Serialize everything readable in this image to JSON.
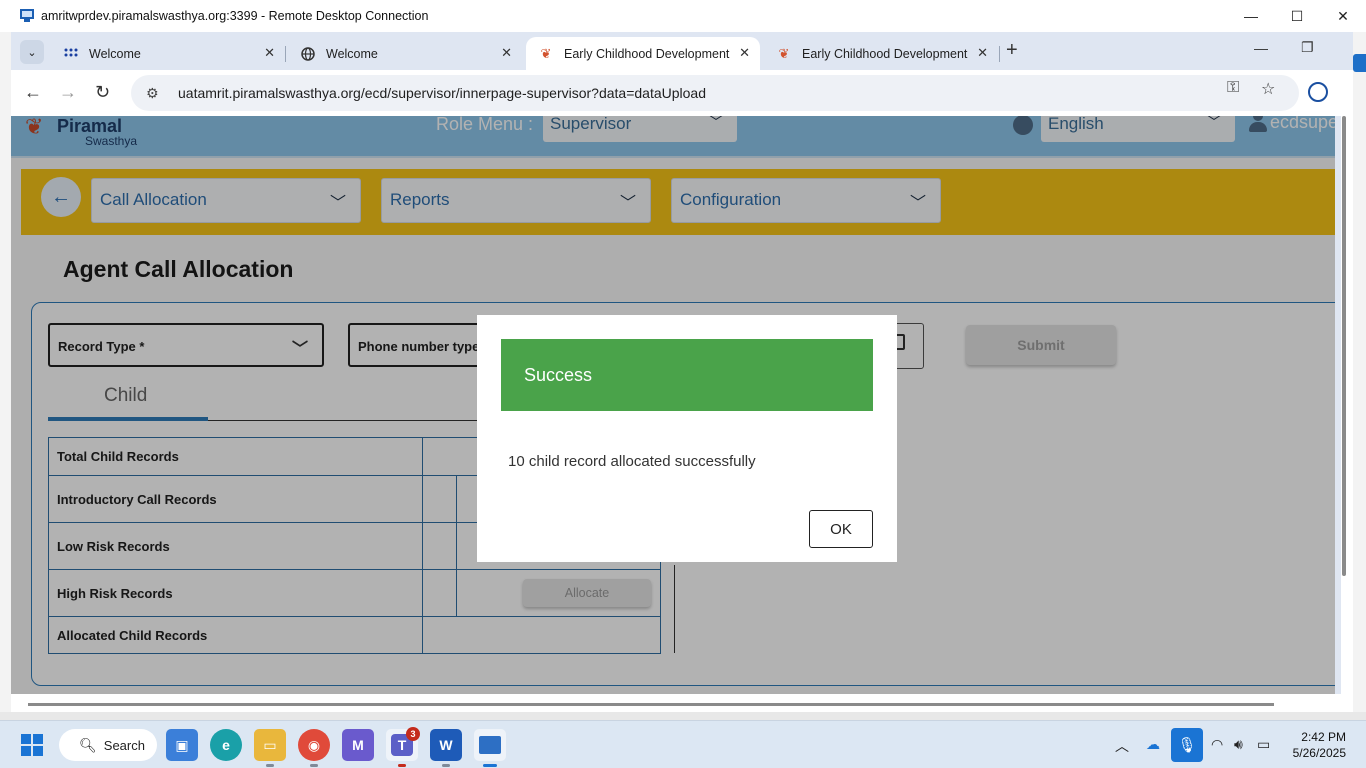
{
  "rdp": {
    "title": "amritwprdev.piramalswasthya.org:3399 - Remote Desktop Connection",
    "min": "—",
    "max": "☐",
    "close": "✕"
  },
  "browser": {
    "tabs": [
      {
        "title": "Welcome",
        "icon": "dots-grid-icon"
      },
      {
        "title": "Welcome",
        "icon": "globe-icon"
      },
      {
        "title": "Early Childhood Development",
        "icon": "piramal-logo-icon",
        "active": true
      },
      {
        "title": "Early Childhood Development",
        "icon": "piramal-logo-icon"
      }
    ],
    "new_tab": "+",
    "url": "uatamrit.piramalswasthya.org/ecd/supervisor/innerpage-supervisor?data=dataUpload"
  },
  "app": {
    "logo_name": "Piramal",
    "logo_sub": "Swasthya",
    "role_label": "Role Menu :",
    "role_value": "Supervisor",
    "language": "English",
    "user": "ecdsupe",
    "menus": [
      "Call Allocation",
      "Reports",
      "Configuration"
    ],
    "page_title": "Agent Call Allocation",
    "fields": {
      "record_type": "Record Type *",
      "phone_type": "Phone number type"
    },
    "submit": "Submit",
    "tab": "Child",
    "rows": [
      "Total Child Records",
      "Introductory Call Records",
      "Low Risk Records",
      "High Risk Records",
      "Allocated Child Records"
    ],
    "allocate": "Allocate"
  },
  "dialog": {
    "title": "Success",
    "message": "10 child record allocated successfully",
    "ok": "OK"
  },
  "taskbar": {
    "search": "Search",
    "teams_badge": "3",
    "time": "2:42 PM",
    "date": "5/26/2025"
  },
  "colors": {
    "header": "#8fc8ec",
    "menubar": "#f7c518",
    "success": "#4aa34a",
    "accent": "#2f7bb9"
  }
}
